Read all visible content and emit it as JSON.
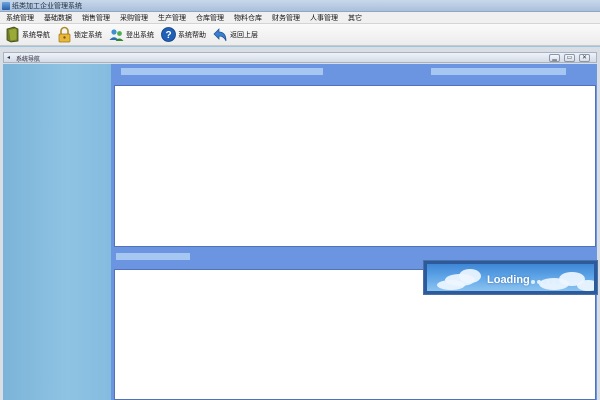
{
  "window": {
    "title": "纸类加工企业管理系统"
  },
  "menu": [
    "系统管理",
    "基础数据",
    "销售管理",
    "采购管理",
    "生产管理",
    "仓库管理",
    "物料仓库",
    "财务管理",
    "人事管理",
    "其它"
  ],
  "toolbar": [
    {
      "label": "系统导航",
      "icon": "book-icon"
    },
    {
      "label": "锁定系统",
      "icon": "lock-icon"
    },
    {
      "label": "登出系统",
      "icon": "users-logout-icon"
    },
    {
      "label": "系统帮助",
      "icon": "help-icon"
    },
    {
      "label": "返回上层",
      "icon": "back-arrow-icon"
    }
  ],
  "nav_window": {
    "title": "系统导航",
    "controls": {
      "minimize": "▁",
      "restore": "▭",
      "close": "✕"
    }
  },
  "loading": {
    "text": "Loading"
  },
  "colors": {
    "sidebar": "#84bcdf",
    "content_header": "#6b95e0",
    "content_bar": "#a5c7f2",
    "panel": "#ffffff",
    "loading_sky": "#5da3e6"
  }
}
